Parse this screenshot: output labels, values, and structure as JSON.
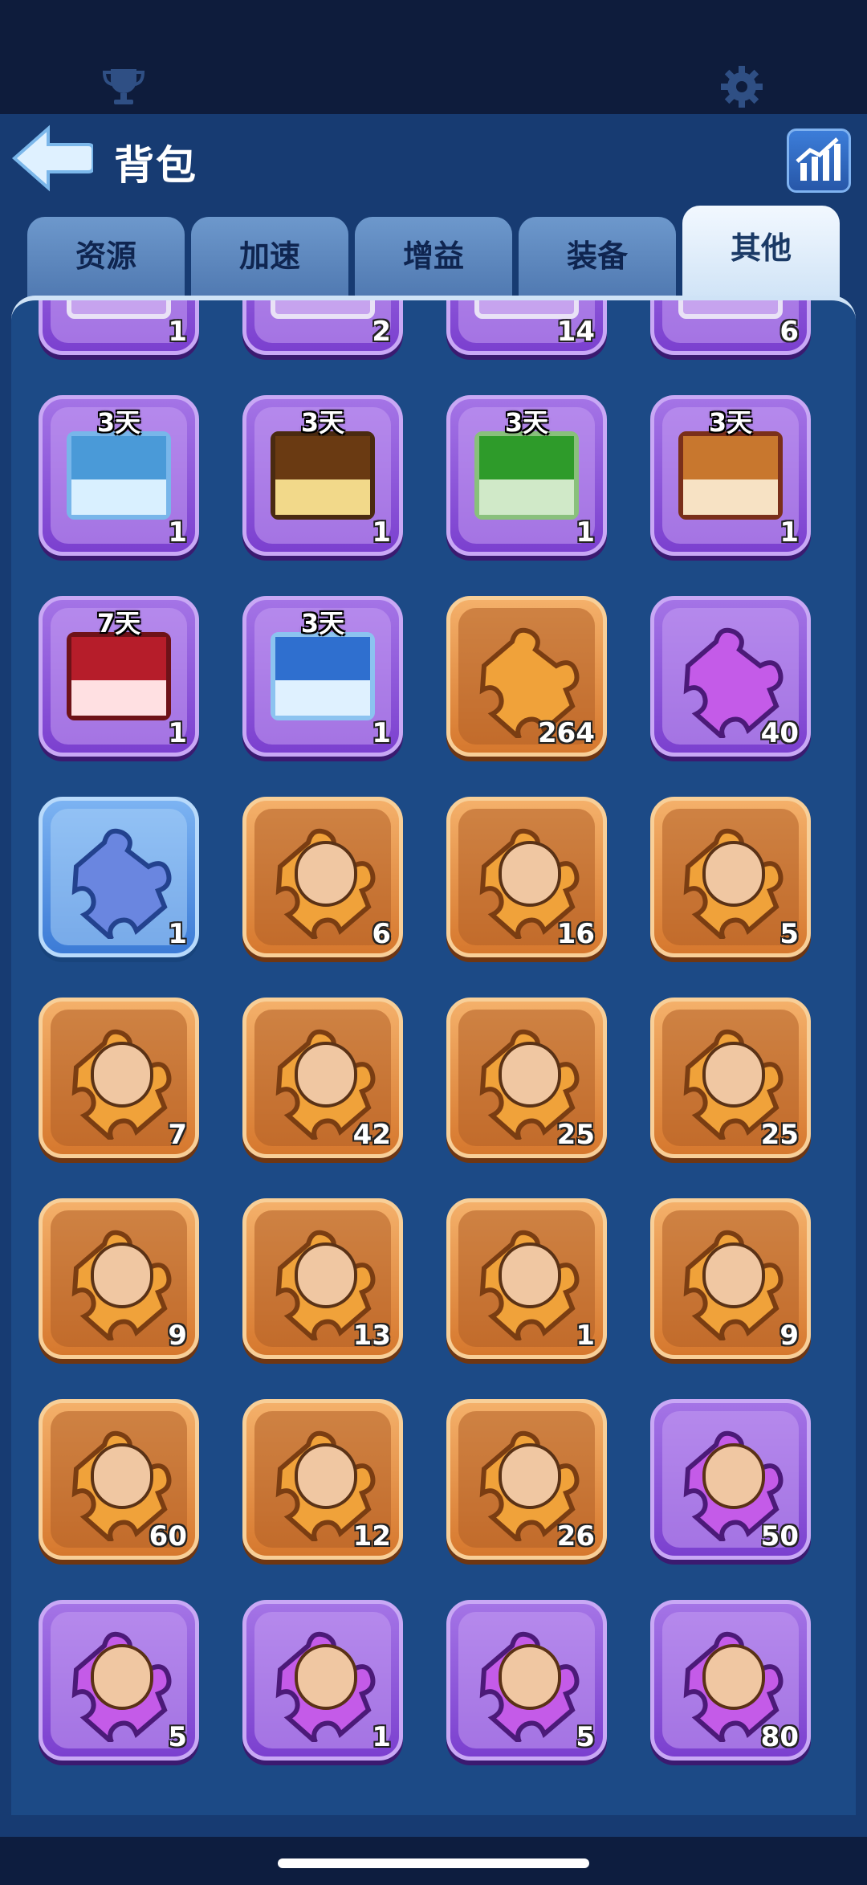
{
  "header": {
    "title": "背包"
  },
  "tabs": [
    {
      "label": "资源",
      "active": false
    },
    {
      "label": "加速",
      "active": false
    },
    {
      "label": "增益",
      "active": false
    },
    {
      "label": "装备",
      "active": false
    },
    {
      "label": "其他",
      "active": true
    }
  ],
  "items": [
    {
      "type": "frame",
      "count": "1"
    },
    {
      "type": "frame",
      "count": "2"
    },
    {
      "type": "frame",
      "count": "14"
    },
    {
      "type": "frame",
      "count": "6"
    },
    {
      "type": "timed-frame",
      "days": "3天",
      "count": "1",
      "top": "#4a9ad8",
      "bot": "#d9f0ff",
      "border": "#78b6ea"
    },
    {
      "type": "timed-frame",
      "days": "3天",
      "count": "1",
      "top": "#6a3a12",
      "bot": "#f2d98a",
      "border": "#4a2a10"
    },
    {
      "type": "timed-frame",
      "days": "3天",
      "count": "1",
      "top": "#2e9b2a",
      "bot": "#d0e9c8",
      "border": "#89c07c"
    },
    {
      "type": "timed-frame",
      "days": "3天",
      "count": "1",
      "top": "#c8772e",
      "bot": "#f7e2c4",
      "border": "#7a2f1a"
    },
    {
      "type": "timed-frame",
      "days": "7天",
      "count": "1",
      "top": "#b61d2a",
      "bot": "#ffe0e2",
      "border": "#6e1218"
    },
    {
      "type": "timed-frame",
      "days": "3天",
      "count": "1",
      "top": "#2f6fcf",
      "bot": "#dff1ff",
      "border": "#8cc3f0"
    },
    {
      "type": "puzzle",
      "rarity": "orange",
      "count": "264"
    },
    {
      "type": "puzzle",
      "rarity": "purple",
      "count": "40"
    },
    {
      "type": "puzzle",
      "rarity": "blue",
      "count": "1"
    },
    {
      "type": "hero-piece",
      "rarity": "orange",
      "count": "6"
    },
    {
      "type": "hero-piece",
      "rarity": "orange",
      "count": "16"
    },
    {
      "type": "hero-piece",
      "rarity": "orange",
      "count": "5"
    },
    {
      "type": "hero-piece",
      "rarity": "orange",
      "count": "7"
    },
    {
      "type": "hero-piece",
      "rarity": "orange",
      "count": "42"
    },
    {
      "type": "hero-piece",
      "rarity": "orange",
      "count": "25"
    },
    {
      "type": "hero-piece",
      "rarity": "orange",
      "count": "25"
    },
    {
      "type": "hero-piece",
      "rarity": "orange",
      "count": "9"
    },
    {
      "type": "hero-piece",
      "rarity": "orange",
      "count": "13"
    },
    {
      "type": "hero-piece",
      "rarity": "orange",
      "count": "1"
    },
    {
      "type": "hero-piece",
      "rarity": "orange",
      "count": "9"
    },
    {
      "type": "hero-piece",
      "rarity": "orange",
      "count": "60"
    },
    {
      "type": "hero-piece",
      "rarity": "orange",
      "count": "12"
    },
    {
      "type": "hero-piece",
      "rarity": "orange",
      "count": "26"
    },
    {
      "type": "hero-piece",
      "rarity": "purple",
      "count": "50"
    },
    {
      "type": "hero-piece",
      "rarity": "purple",
      "count": "5"
    },
    {
      "type": "hero-piece",
      "rarity": "purple",
      "count": "1"
    },
    {
      "type": "hero-piece",
      "rarity": "purple",
      "count": "5"
    },
    {
      "type": "hero-piece",
      "rarity": "purple",
      "count": "80"
    }
  ],
  "icons": {
    "trophy": "trophy-icon",
    "settings": "gear-icon",
    "back": "back-arrow-icon",
    "stats": "bar-chart-icon"
  },
  "colors": {
    "background": "#173b72",
    "panel": "#1c4a86",
    "tab": "#5b86bf",
    "active_tab": "#e6f1fb"
  }
}
